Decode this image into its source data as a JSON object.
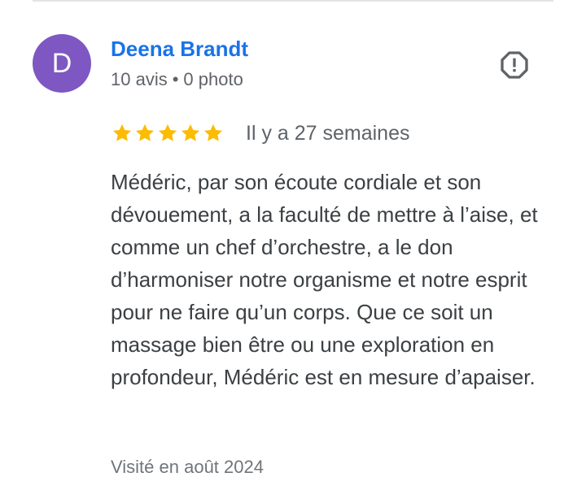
{
  "author": {
    "initial": "D",
    "name": "Deena Brandt",
    "reviews_count": "10 avis",
    "separator": "•",
    "photos_count": "0 photo",
    "avatar_color": "#7e57c2"
  },
  "review": {
    "rating": 5,
    "max_rating": 5,
    "star_color": "#fbbc04",
    "time": "Il y a 27 semaines",
    "text": "Médéric, par son écoute cordiale et son dévouement, a la faculté de mettre à l’aise, et comme un chef d’orchestre, a le don d’harmoniser notre organisme et notre esprit pour ne faire qu’un corps. Que ce soit un massage bien être ou une exploration en profondeur, Médéric est en mesure d’apaiser.",
    "visit": "Visité en août 2024"
  },
  "icons": {
    "report": "report-flag-icon",
    "star": "star-icon"
  },
  "colors": {
    "link": "#1a73e8",
    "secondary_text": "#5f6368",
    "body_text": "#3c4043",
    "icon": "#5f6368",
    "divider": "#e3e3e3"
  }
}
